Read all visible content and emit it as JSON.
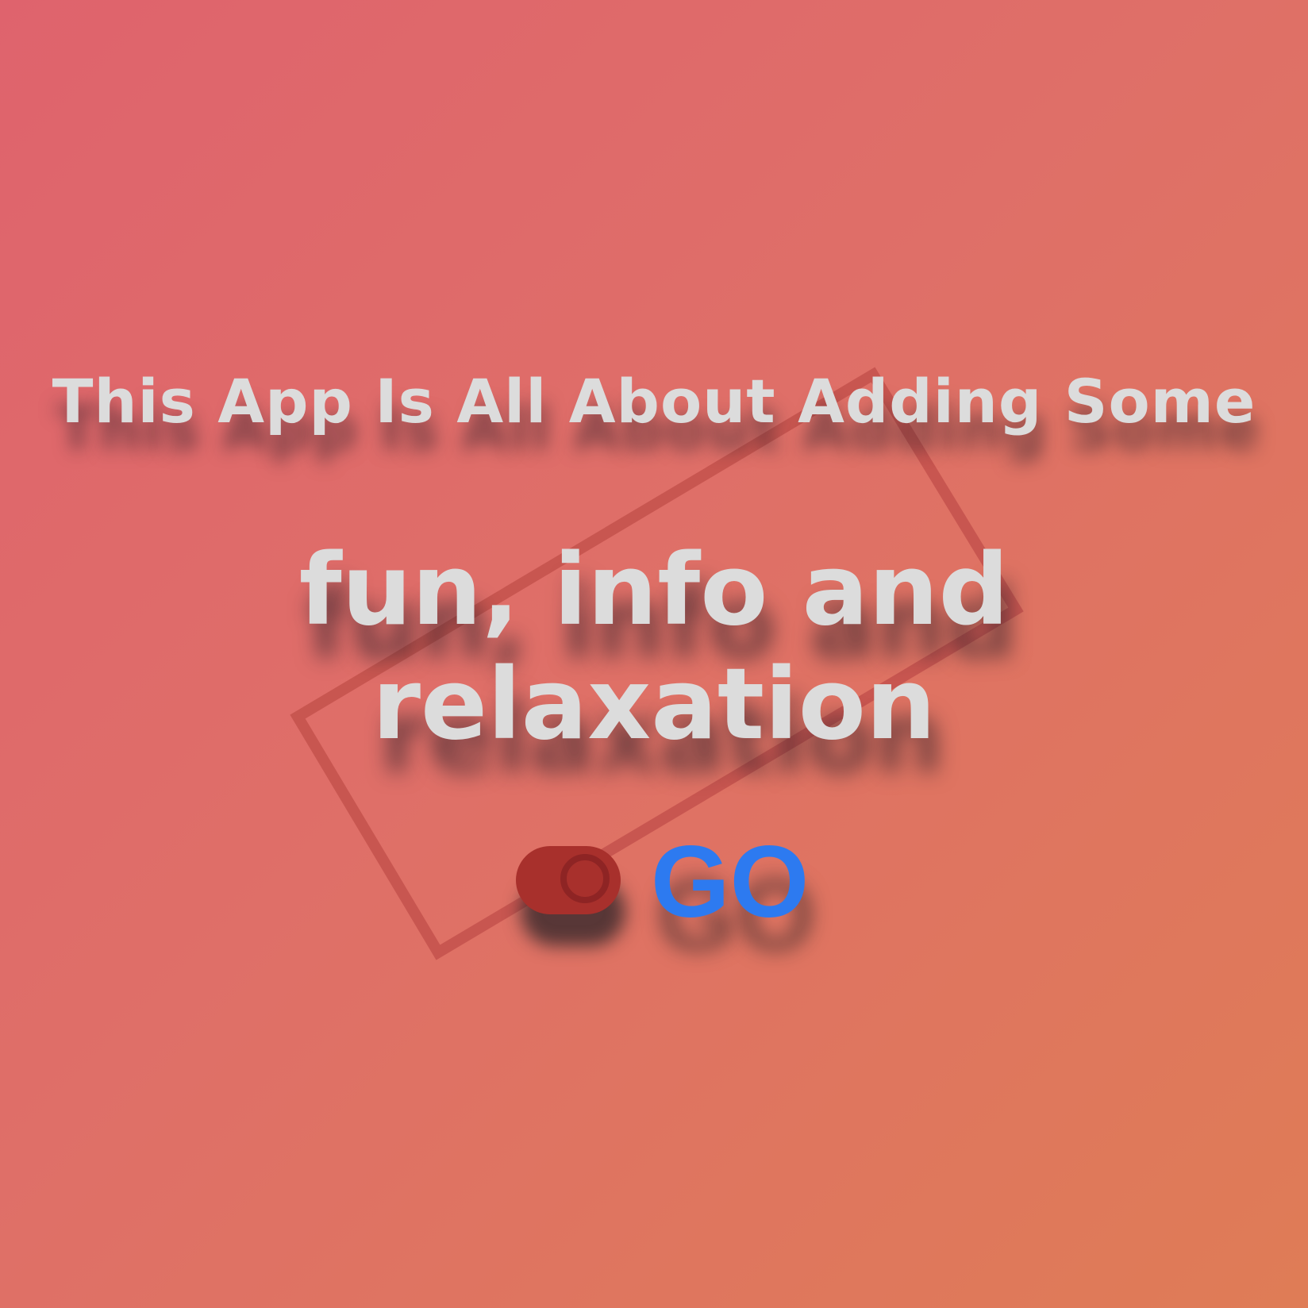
{
  "intro": {
    "tagline": "This App Is All About Adding Some",
    "hero": "fun, info and relaxation"
  },
  "actions": {
    "go_label": "GO",
    "go_color": "#2d7af0",
    "toggle_color": "#a8302c"
  },
  "background": {
    "gradient_start": "#df636d",
    "gradient_end": "#df7c56"
  }
}
